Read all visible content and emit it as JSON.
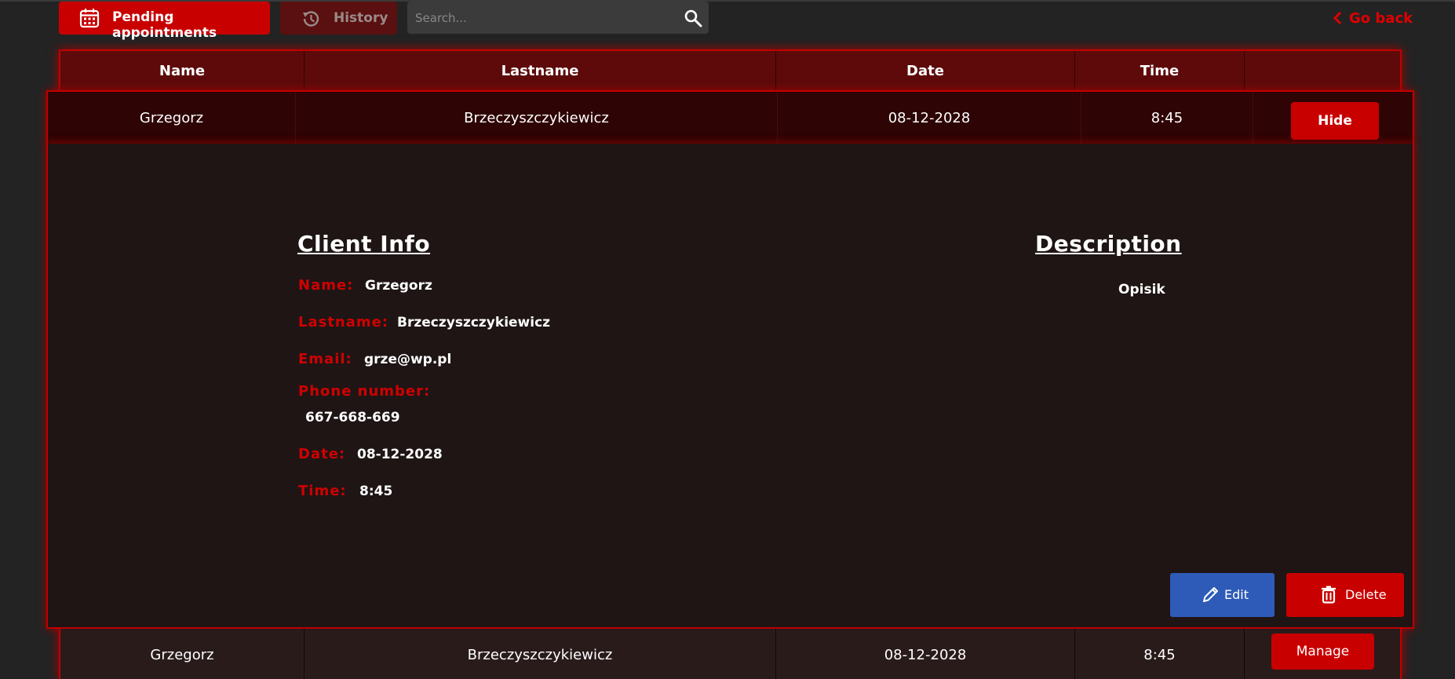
{
  "toolbar": {
    "pending_label": "Pending appointments",
    "history_label": "History",
    "search_placeholder": "Search...",
    "go_back_label": "Go back"
  },
  "table": {
    "headers": [
      "Name",
      "Lastname",
      "Date",
      "Time",
      ""
    ],
    "rows": [
      {
        "name": "Grzegorz",
        "lastname": "Brzeczyszczykiewicz",
        "date": "08-12-2028",
        "time": "8:45",
        "action": "Hide"
      },
      {
        "name": "Grzegorz",
        "lastname": "Brzeczyszczykiewicz",
        "date": "08-12-2028",
        "time": "8:45",
        "action": "Manage"
      }
    ]
  },
  "details": {
    "client_info_title": "Client Info",
    "description_title": "Description",
    "fields": {
      "name_label": "Name:",
      "name_value": "Grzegorz",
      "lastname_label": "Lastname:",
      "lastname_value": "Brzeczyszczykiewicz",
      "email_label": "Email:",
      "email_value": "grze@wp.pl",
      "phone_label": "Phone number:",
      "phone_value": "667-668-669",
      "date_label": "Date:",
      "date_value": "08-12-2028",
      "time_label": "Time:",
      "time_value": "8:45"
    },
    "description_text": "Opisik",
    "edit_label": "Edit",
    "delete_label": "Delete"
  },
  "colors": {
    "accent_red": "#c80000",
    "edit_blue": "#2f5bb8",
    "background": "#232323"
  },
  "icons": {
    "pending": "calendar-icon",
    "history": "history-icon",
    "search": "search-icon",
    "go_back": "chevron-left-icon",
    "edit": "pencil-icon",
    "delete": "trash-icon"
  }
}
